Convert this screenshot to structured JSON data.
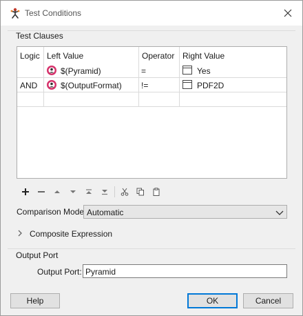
{
  "window": {
    "title": "Test Conditions",
    "title_icon": "fme-workbench-icon",
    "close_icon": "close-icon"
  },
  "clauses": {
    "group_label": "Test Clauses",
    "columns": [
      "Logic",
      "Left Value",
      "Operator",
      "Right Value"
    ],
    "rows": [
      {
        "logic": "",
        "left": "$(Pyramid)",
        "operator": "=",
        "right": "Yes"
      },
      {
        "logic": "AND",
        "left": "$(OutputFormat)",
        "operator": "!=",
        "right": "PDF2D"
      }
    ],
    "toolbar_icons": [
      "add-icon",
      "remove-icon",
      "move-up-icon",
      "move-down-icon",
      "move-top-icon",
      "move-bottom-icon",
      "cut-icon",
      "copy-icon",
      "paste-icon"
    ]
  },
  "comparison": {
    "label": "Comparison Mode:",
    "value": "Automatic"
  },
  "composite": {
    "label": "Composite Expression"
  },
  "output": {
    "group_label": "Output Port",
    "label": "Output Port:",
    "value": "Pyramid"
  },
  "buttons": {
    "help": "Help",
    "ok": "OK",
    "cancel": "Cancel"
  },
  "colors": {
    "accent": "#0078d7",
    "window_bg": "#f0f0f0",
    "table_bg": "#ffffff"
  }
}
